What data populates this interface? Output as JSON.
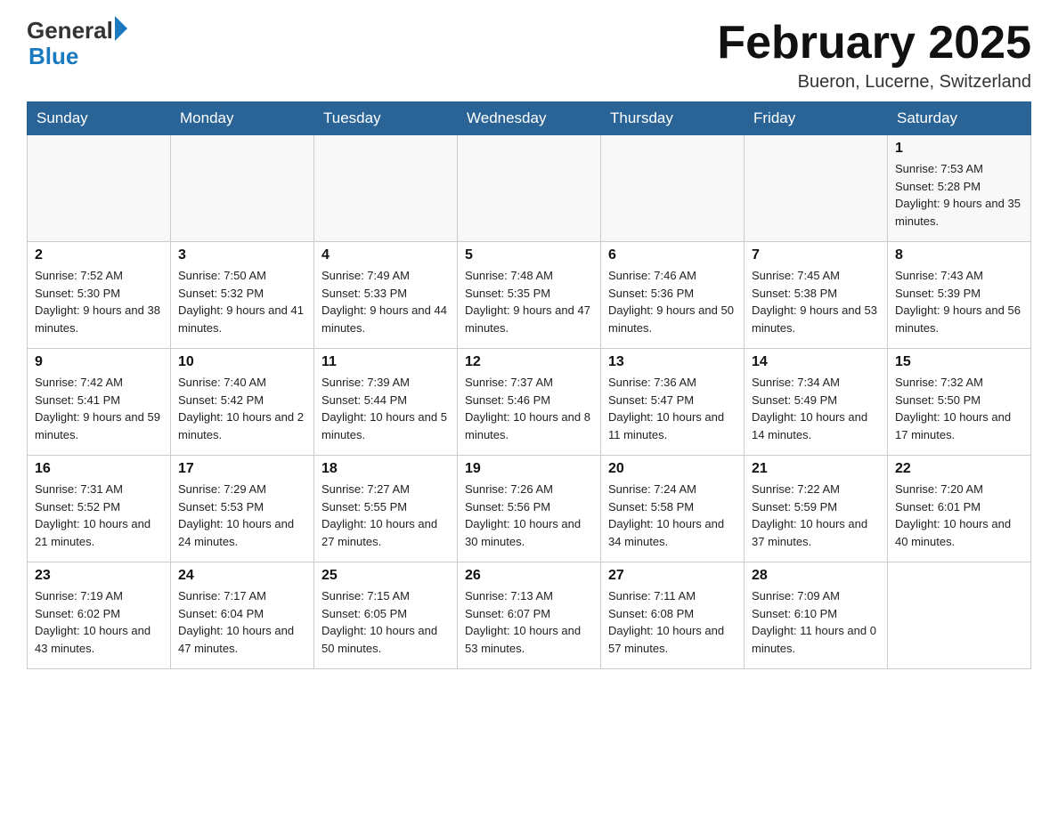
{
  "header": {
    "logo_general": "General",
    "logo_blue": "Blue",
    "month_title": "February 2025",
    "location": "Bueron, Lucerne, Switzerland"
  },
  "weekdays": [
    "Sunday",
    "Monday",
    "Tuesday",
    "Wednesday",
    "Thursday",
    "Friday",
    "Saturday"
  ],
  "weeks": [
    [
      {
        "day": "",
        "info": ""
      },
      {
        "day": "",
        "info": ""
      },
      {
        "day": "",
        "info": ""
      },
      {
        "day": "",
        "info": ""
      },
      {
        "day": "",
        "info": ""
      },
      {
        "day": "",
        "info": ""
      },
      {
        "day": "1",
        "info": "Sunrise: 7:53 AM\nSunset: 5:28 PM\nDaylight: 9 hours and 35 minutes."
      }
    ],
    [
      {
        "day": "2",
        "info": "Sunrise: 7:52 AM\nSunset: 5:30 PM\nDaylight: 9 hours and 38 minutes."
      },
      {
        "day": "3",
        "info": "Sunrise: 7:50 AM\nSunset: 5:32 PM\nDaylight: 9 hours and 41 minutes."
      },
      {
        "day": "4",
        "info": "Sunrise: 7:49 AM\nSunset: 5:33 PM\nDaylight: 9 hours and 44 minutes."
      },
      {
        "day": "5",
        "info": "Sunrise: 7:48 AM\nSunset: 5:35 PM\nDaylight: 9 hours and 47 minutes."
      },
      {
        "day": "6",
        "info": "Sunrise: 7:46 AM\nSunset: 5:36 PM\nDaylight: 9 hours and 50 minutes."
      },
      {
        "day": "7",
        "info": "Sunrise: 7:45 AM\nSunset: 5:38 PM\nDaylight: 9 hours and 53 minutes."
      },
      {
        "day": "8",
        "info": "Sunrise: 7:43 AM\nSunset: 5:39 PM\nDaylight: 9 hours and 56 minutes."
      }
    ],
    [
      {
        "day": "9",
        "info": "Sunrise: 7:42 AM\nSunset: 5:41 PM\nDaylight: 9 hours and 59 minutes."
      },
      {
        "day": "10",
        "info": "Sunrise: 7:40 AM\nSunset: 5:42 PM\nDaylight: 10 hours and 2 minutes."
      },
      {
        "day": "11",
        "info": "Sunrise: 7:39 AM\nSunset: 5:44 PM\nDaylight: 10 hours and 5 minutes."
      },
      {
        "day": "12",
        "info": "Sunrise: 7:37 AM\nSunset: 5:46 PM\nDaylight: 10 hours and 8 minutes."
      },
      {
        "day": "13",
        "info": "Sunrise: 7:36 AM\nSunset: 5:47 PM\nDaylight: 10 hours and 11 minutes."
      },
      {
        "day": "14",
        "info": "Sunrise: 7:34 AM\nSunset: 5:49 PM\nDaylight: 10 hours and 14 minutes."
      },
      {
        "day": "15",
        "info": "Sunrise: 7:32 AM\nSunset: 5:50 PM\nDaylight: 10 hours and 17 minutes."
      }
    ],
    [
      {
        "day": "16",
        "info": "Sunrise: 7:31 AM\nSunset: 5:52 PM\nDaylight: 10 hours and 21 minutes."
      },
      {
        "day": "17",
        "info": "Sunrise: 7:29 AM\nSunset: 5:53 PM\nDaylight: 10 hours and 24 minutes."
      },
      {
        "day": "18",
        "info": "Sunrise: 7:27 AM\nSunset: 5:55 PM\nDaylight: 10 hours and 27 minutes."
      },
      {
        "day": "19",
        "info": "Sunrise: 7:26 AM\nSunset: 5:56 PM\nDaylight: 10 hours and 30 minutes."
      },
      {
        "day": "20",
        "info": "Sunrise: 7:24 AM\nSunset: 5:58 PM\nDaylight: 10 hours and 34 minutes."
      },
      {
        "day": "21",
        "info": "Sunrise: 7:22 AM\nSunset: 5:59 PM\nDaylight: 10 hours and 37 minutes."
      },
      {
        "day": "22",
        "info": "Sunrise: 7:20 AM\nSunset: 6:01 PM\nDaylight: 10 hours and 40 minutes."
      }
    ],
    [
      {
        "day": "23",
        "info": "Sunrise: 7:19 AM\nSunset: 6:02 PM\nDaylight: 10 hours and 43 minutes."
      },
      {
        "day": "24",
        "info": "Sunrise: 7:17 AM\nSunset: 6:04 PM\nDaylight: 10 hours and 47 minutes."
      },
      {
        "day": "25",
        "info": "Sunrise: 7:15 AM\nSunset: 6:05 PM\nDaylight: 10 hours and 50 minutes."
      },
      {
        "day": "26",
        "info": "Sunrise: 7:13 AM\nSunset: 6:07 PM\nDaylight: 10 hours and 53 minutes."
      },
      {
        "day": "27",
        "info": "Sunrise: 7:11 AM\nSunset: 6:08 PM\nDaylight: 10 hours and 57 minutes."
      },
      {
        "day": "28",
        "info": "Sunrise: 7:09 AM\nSunset: 6:10 PM\nDaylight: 11 hours and 0 minutes."
      },
      {
        "day": "",
        "info": ""
      }
    ]
  ]
}
